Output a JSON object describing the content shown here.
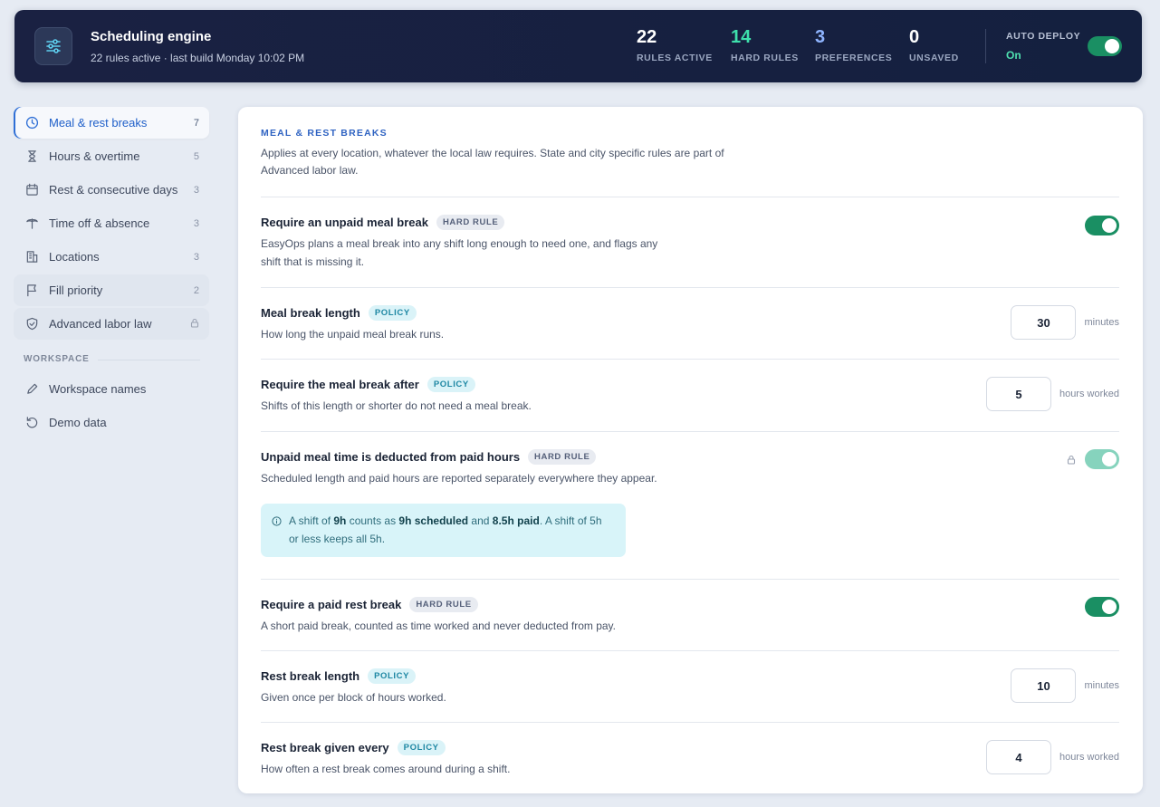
{
  "header": {
    "title": "Scheduling engine",
    "subtitle": "22 rules active · last build Monday 10:02 PM",
    "stats": [
      {
        "value": "22",
        "label": "RULES ACTIVE",
        "color": "#ffffff"
      },
      {
        "value": "14",
        "label": "HARD RULES",
        "color": "#3ee0ac"
      },
      {
        "value": "3",
        "label": "PREFERENCES",
        "color": "#8fb4ff"
      },
      {
        "value": "0",
        "label": "UNSAVED",
        "color": "#ffffff"
      }
    ],
    "auto_deploy_label": "AUTO DEPLOY",
    "auto_deploy_state": "On"
  },
  "sidebar": {
    "items": [
      {
        "label": "Meal & rest breaks",
        "count": "7",
        "icon": "clock-icon"
      },
      {
        "label": "Hours & overtime",
        "count": "5",
        "icon": "hourglass-icon"
      },
      {
        "label": "Rest & consecutive days",
        "count": "3",
        "icon": "calendar-icon"
      },
      {
        "label": "Time off & absence",
        "count": "3",
        "icon": "umbrella-icon"
      },
      {
        "label": "Locations",
        "count": "3",
        "icon": "building-icon"
      },
      {
        "label": "Fill priority",
        "count": "2",
        "icon": "flag-icon"
      },
      {
        "label": "Advanced labor law",
        "count": "",
        "icon": "shield-icon"
      }
    ],
    "workspace_label": "WORKSPACE",
    "workspace_items": [
      {
        "label": "Workspace names",
        "icon": "pencil-icon"
      },
      {
        "label": "Demo data",
        "icon": "reset-icon"
      }
    ]
  },
  "main": {
    "section_title": "MEAL & REST BREAKS",
    "section_desc": "Applies at every location, whatever the local law requires. State and city specific rules are part of Advanced labor law.",
    "rules": [
      {
        "title": "Require an unpaid meal break",
        "tag": "HARD RULE",
        "desc": "EasyOps plans a meal break into any shift long enough to need one, and flags any shift that is missing it.",
        "control": "toggle",
        "on": true
      },
      {
        "title": "Meal break length",
        "tag": "POLICY",
        "desc": "How long the unpaid meal break runs.",
        "control": "number",
        "value": "30",
        "unit": "minutes"
      },
      {
        "title": "Require the meal break after",
        "tag": "POLICY",
        "desc": "Shifts of this length or shorter do not need a meal break.",
        "control": "number",
        "value": "5",
        "unit": "hours worked"
      },
      {
        "title": "Unpaid meal time is deducted from paid hours",
        "tag": "HARD RULE",
        "desc": "Scheduled length and paid hours are reported separately everywhere they appear.",
        "control": "locked-toggle",
        "on": true,
        "info": {
          "p1": "A shift of ",
          "b1": "9h",
          "p2": " counts as ",
          "b2": "9h scheduled",
          "p3": " and ",
          "b3": "8.5h paid",
          "p4": ". A shift of 5h or less keeps all 5h."
        }
      },
      {
        "title": "Require a paid rest break",
        "tag": "HARD RULE",
        "desc": "A short paid break, counted as time worked and never deducted from pay.",
        "control": "toggle",
        "on": true
      },
      {
        "title": "Rest break length",
        "tag": "POLICY",
        "desc": "Given once per block of hours worked.",
        "control": "number",
        "value": "10",
        "unit": "minutes"
      },
      {
        "title": "Rest break given every",
        "tag": "POLICY",
        "desc": "How often a rest break comes around during a shift.",
        "control": "number",
        "value": "4",
        "unit": "hours worked"
      }
    ]
  },
  "colors": {
    "accent": "#2f6fd6",
    "toggle_on": "#1a8f63",
    "header_bg": "#1a2142"
  }
}
